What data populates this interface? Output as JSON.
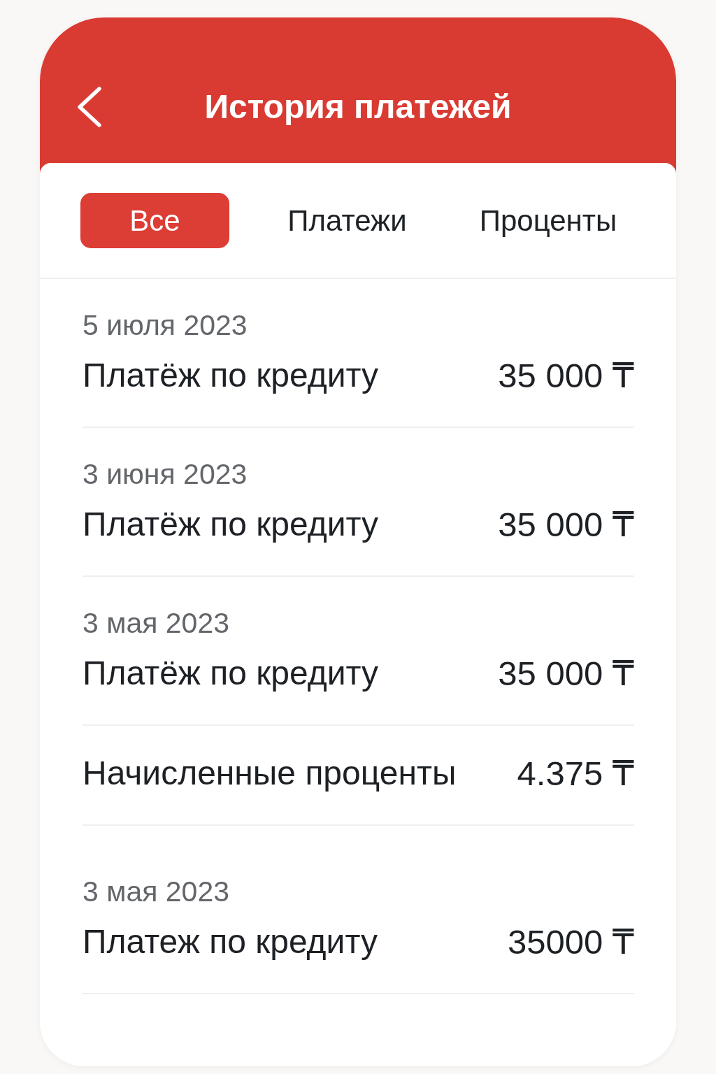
{
  "header": {
    "title": "История платежей"
  },
  "tabs": [
    {
      "label": "Все",
      "selected": true
    },
    {
      "label": "Платежи",
      "selected": false
    },
    {
      "label": "Проценты",
      "selected": false
    }
  ],
  "transactions": [
    {
      "date": "5 июля 2023",
      "title": "Платёж по кредиту",
      "amount": "35 000 ₸"
    },
    {
      "date": "3 июня 2023",
      "title": "Платёж по кредиту",
      "amount": "35 000 ₸"
    },
    {
      "date": "3 мая 2023",
      "title": "Платёж по кредиту",
      "amount": "35 000 ₸"
    },
    {
      "title": "Начисленные проценты",
      "amount": "4.375 ₸"
    },
    {
      "date": "3 мая 2023",
      "title": "Платеж по кредиту",
      "amount": "35000 ₸"
    }
  ]
}
